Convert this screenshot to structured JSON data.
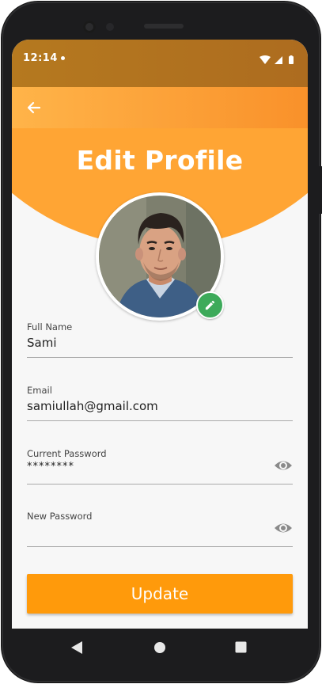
{
  "status_bar": {
    "time": "12:14",
    "icons": [
      "notification-dot-icon",
      "wifi-icon",
      "signal-icon",
      "battery-icon"
    ]
  },
  "app_bar": {
    "back_icon": "arrow-left-icon"
  },
  "header": {
    "title": "Edit Profile",
    "avatar_edit_icon": "pencil-icon"
  },
  "form": {
    "full_name": {
      "label": "Full Name",
      "value": "Sami"
    },
    "email": {
      "label": "Email",
      "value": "samiullah@gmail.com"
    },
    "current_password": {
      "label": "Current Password",
      "value": "********",
      "toggle_icon": "eye-icon"
    },
    "new_password": {
      "label": "New Password",
      "value": "",
      "toggle_icon": "eye-icon"
    }
  },
  "actions": {
    "update_label": "Update"
  },
  "nav_bar": {
    "buttons": [
      "back-triangle-icon",
      "home-circle-icon",
      "recents-square-icon"
    ]
  },
  "colors": {
    "status_bar": "#b5791f",
    "app_bar": "#ffb449",
    "header": "#ffa534",
    "accent": "#ff9a0b",
    "edit_badge": "#3daa5a",
    "screen_bg": "#f7f7f7"
  }
}
